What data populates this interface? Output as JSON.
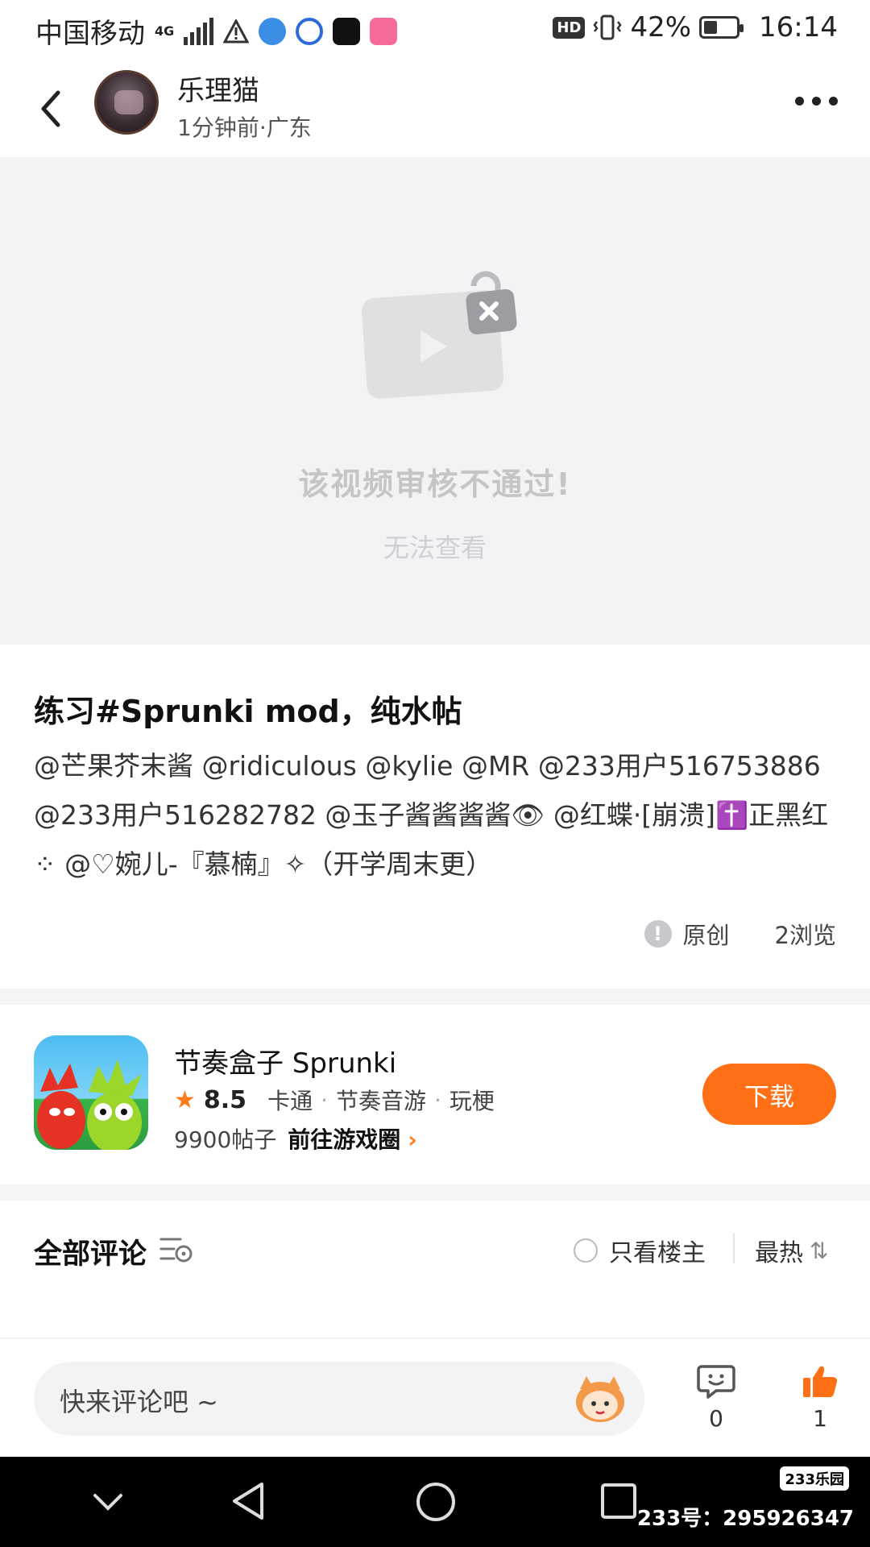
{
  "status_bar": {
    "carrier": "中国移动",
    "network": "4G",
    "hd": "HD",
    "battery_percent": "42%",
    "battery_level": 0.42,
    "time": "16:14"
  },
  "header": {
    "username": "乐理猫",
    "meta": "1分钟前·广东"
  },
  "video": {
    "blocked_title": "该视频审核不通过!",
    "blocked_sub": "无法查看"
  },
  "post": {
    "title": "练习#Sprunki mod，纯水帖",
    "body": "@芒果芥末酱 @ridiculous @kylie @MR @233用户516753886 @233用户516282782 @玉子酱酱酱酱👁 @红蝶·[崩溃]✝️正黑红 ⁘ @♡婉儿-『慕楠』✧（开学周末更）",
    "tag_original": "原创",
    "views": "2浏览"
  },
  "game": {
    "name": "节奏盒子 Sprunki",
    "rating": "8.5",
    "tags": [
      "卡通",
      "节奏音游",
      "玩梗"
    ],
    "posts": "9900帖子",
    "goto_label": "前往游戏圈",
    "download_label": "下载"
  },
  "comments": {
    "title": "全部评论",
    "only_host": "只看楼主",
    "sort": "最热"
  },
  "bottom_bar": {
    "placeholder": "快来评论吧 ~",
    "comment_count": "0",
    "like_count": "1"
  },
  "watermark": {
    "badge": "233乐园",
    "text": "233号：295926347"
  },
  "colors": {
    "accent": "#ff7016",
    "blocked_bg": "#f3f3f5"
  }
}
